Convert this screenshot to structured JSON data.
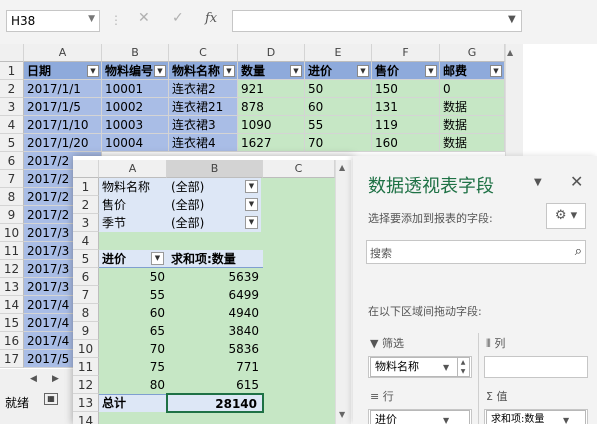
{
  "formula_bar": {
    "name_box": "H38",
    "cancel_glyph": "✕",
    "enter_glyph": "✓",
    "fx_label": "fx",
    "formula": ""
  },
  "grid": {
    "columns": [
      "A",
      "B",
      "C",
      "D",
      "E",
      "F",
      "G"
    ],
    "rows": [
      "1",
      "2",
      "3",
      "4",
      "5",
      "6",
      "7",
      "8",
      "9",
      "10",
      "11",
      "12",
      "13",
      "14",
      "15",
      "16",
      "17"
    ],
    "headers": [
      "日期",
      "物料编号",
      "物料名称",
      "数量",
      "进价",
      "售价",
      "邮费"
    ],
    "data": [
      [
        "2017/1/1",
        "10001",
        "连衣裙2",
        "921",
        "50",
        "150",
        "0"
      ],
      [
        "2017/1/5",
        "10002",
        "连衣裙21",
        "878",
        "60",
        "131",
        "数据"
      ],
      [
        "2017/1/10",
        "10003",
        "连衣裙3",
        "1090",
        "55",
        "119",
        "数据"
      ],
      [
        "2017/1/20",
        "10004",
        "连衣裙4",
        "1627",
        "70",
        "160",
        "数据"
      ]
    ],
    "col_a_partial": [
      "2017/2",
      "2017/2",
      "2017/2",
      "2017/2",
      "2017/3",
      "2017/3",
      "2017/3",
      "2017/3",
      "2017/4",
      "2017/4",
      "2017/4",
      "2017/5"
    ]
  },
  "status_bar": {
    "ready": "就绪"
  },
  "pivot_sheet": {
    "columns": [
      "A",
      "B",
      "C"
    ],
    "rows": [
      "1",
      "2",
      "3",
      "4",
      "5",
      "6",
      "7",
      "8",
      "9",
      "10",
      "11",
      "12",
      "13",
      "14",
      "15"
    ],
    "filters": [
      {
        "label": "物料名称",
        "value": "(全部)"
      },
      {
        "label": "售价",
        "value": "(全部)"
      },
      {
        "label": "季节",
        "value": "(全部)"
      }
    ],
    "row_header": "进价",
    "value_header": "求和项:数量",
    "rows_data": [
      {
        "key": "50",
        "value": "5639"
      },
      {
        "key": "55",
        "value": "6499"
      },
      {
        "key": "60",
        "value": "4940"
      },
      {
        "key": "65",
        "value": "3840"
      },
      {
        "key": "70",
        "value": "5836"
      },
      {
        "key": "75",
        "value": "771"
      },
      {
        "key": "80",
        "value": "615"
      }
    ],
    "total_label": "总计",
    "total_value": "28140"
  },
  "field_pane": {
    "title": "数据透视表字段",
    "choose_label": "选择要添加到报表的字段:",
    "search_placeholder": "搜索",
    "drag_label": "在以下区域间拖动字段:",
    "filters_label": "筛选",
    "columns_label": "列",
    "rows_label": "行",
    "values_label": "值",
    "filter_chip": "物料名称",
    "row_chip": "进价",
    "value_chip": "求和项:数量"
  },
  "colors": {
    "header_blue": "#8eaadb",
    "cell_blue": "#a9bde6",
    "cell_green": "#c6e7c5",
    "accent_green": "#1e7145"
  },
  "icons": [
    "dropdown-icon",
    "cancel-icon",
    "check-icon",
    "fx-icon",
    "filter-icon",
    "gear-icon",
    "search-icon",
    "close-icon",
    "columns-icon",
    "rows-icon",
    "sigma-icon"
  ]
}
